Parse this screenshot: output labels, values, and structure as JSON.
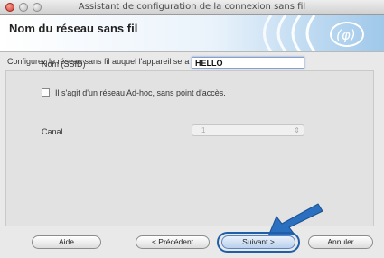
{
  "window": {
    "title": "Assistant de configuration de la connexion sans fil"
  },
  "header": {
    "page_title": "Nom du réseau sans fil",
    "logo_icon": "wifi-logo-icon"
  },
  "main": {
    "instruction": "Configurez le réseau sans fil auquel l'appareil sera associé.",
    "ssid_label": "Nom (SSID)",
    "ssid_value": "HELLO",
    "adhoc_label": "Il s'agit d'un réseau Ad-hoc, sans point d'accès.",
    "adhoc_checked": false,
    "channel_label": "Canal",
    "channel_value": "1"
  },
  "footer": {
    "help": "Aide",
    "back": "< Précédent",
    "next": "Suivant >",
    "cancel": "Annuler"
  },
  "colors": {
    "accent": "#1f5fa8",
    "arrow": "#2a6fc0"
  }
}
